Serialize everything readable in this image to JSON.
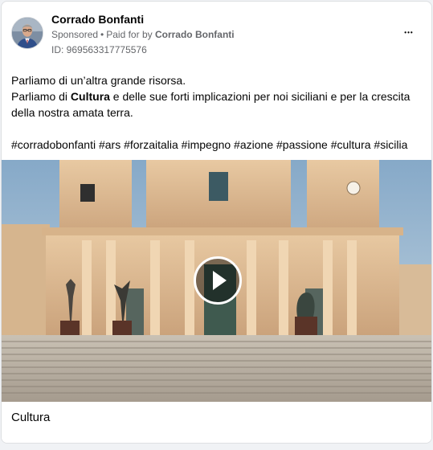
{
  "post": {
    "author": "Corrado Bonfanti",
    "sponsored_label": "Sponsored",
    "dot": "•",
    "paid_for_prefix": "Paid for by",
    "paid_for_name": "Corrado Bonfanti",
    "ad_id": "ID: 969563317775576",
    "more_icon": "more-horizontal-icon",
    "more_label": "•••"
  },
  "text": {
    "line1": "Parliamo di un’altra grande risorsa.",
    "line2_pre": "Parliamo di ",
    "line2_bold": "Cultura",
    "line2_post": " e delle sue forti implicazioni per noi siciliani e per la crescita della nostra amata terra.",
    "hashtags": "#corradobonfanti #ars #forzaitalia #impegno #azione #passione #cultura #sicilia"
  },
  "media": {
    "type": "video",
    "play_icon": "play-icon"
  },
  "caption": {
    "title": "Cultura"
  }
}
